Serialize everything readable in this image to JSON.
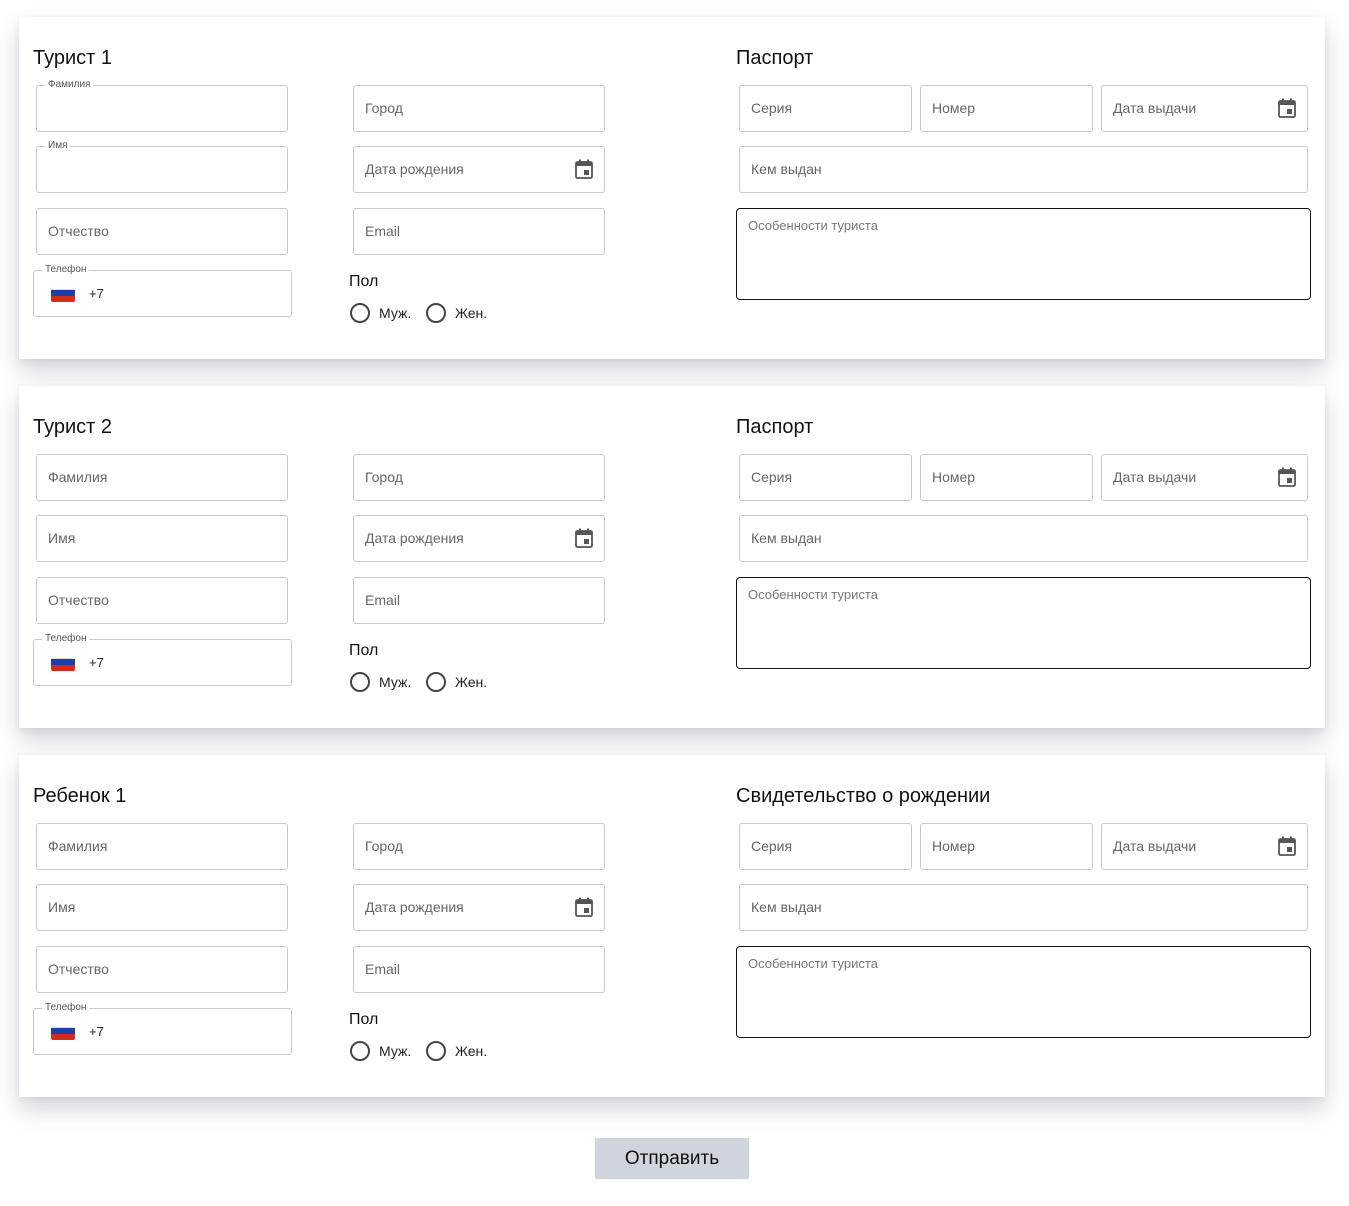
{
  "sections": [
    {
      "title": "Турист 1",
      "doc_title": "Паспорт",
      "last_name": {
        "label": "Фамилия"
      },
      "first_name": {
        "label": "Имя"
      },
      "patronymic": {
        "label": "Отчество"
      },
      "phone": {
        "label": "Телефон",
        "code": "+7"
      },
      "city": {
        "placeholder": "Город"
      },
      "birth_date": {
        "placeholder": "Дата рождения"
      },
      "email": {
        "placeholder": "Email"
      },
      "sex": {
        "label": "Пол",
        "male": "Муж.",
        "female": "Жен."
      },
      "doc_series": {
        "placeholder": "Серия"
      },
      "doc_number": {
        "placeholder": "Номер"
      },
      "doc_issue_date": {
        "placeholder": "Дата выдачи"
      },
      "doc_issued_by": {
        "placeholder": "Кем выдан"
      },
      "notes": {
        "placeholder": "Особенности туриста"
      }
    },
    {
      "title": "Турист 2",
      "doc_title": "Паспорт",
      "last_name": {
        "placeholder": "Фамилия"
      },
      "first_name": {
        "placeholder": "Имя"
      },
      "patronymic": {
        "placeholder": "Отчество"
      },
      "phone": {
        "label": "Телефон",
        "code": "+7"
      },
      "city": {
        "placeholder": "Город"
      },
      "birth_date": {
        "placeholder": "Дата рождения"
      },
      "email": {
        "placeholder": "Email"
      },
      "sex": {
        "label": "Пол",
        "male": "Муж.",
        "female": "Жен."
      },
      "doc_series": {
        "placeholder": "Серия"
      },
      "doc_number": {
        "placeholder": "Номер"
      },
      "doc_issue_date": {
        "placeholder": "Дата выдачи"
      },
      "doc_issued_by": {
        "placeholder": "Кем выдан"
      },
      "notes": {
        "placeholder": "Особенности туриста"
      }
    },
    {
      "title": "Ребенок 1",
      "doc_title": "Свидетельство о рождении",
      "last_name": {
        "placeholder": "Фамилия"
      },
      "first_name": {
        "placeholder": "Имя"
      },
      "patronymic": {
        "placeholder": "Отчество"
      },
      "phone": {
        "label": "Телефон",
        "code": "+7"
      },
      "city": {
        "placeholder": "Город"
      },
      "birth_date": {
        "placeholder": "Дата рождения"
      },
      "email": {
        "placeholder": "Email"
      },
      "sex": {
        "label": "Пол",
        "male": "Муж.",
        "female": "Жен."
      },
      "doc_series": {
        "placeholder": "Серия"
      },
      "doc_number": {
        "placeholder": "Номер"
      },
      "doc_issue_date": {
        "placeholder": "Дата выдачи"
      },
      "doc_issued_by": {
        "placeholder": "Кем выдан"
      },
      "notes": {
        "placeholder": "Особенности туриста"
      }
    }
  ],
  "flag_colors": [
    "#ffffff",
    "#1c3fa6",
    "#d52b1e"
  ],
  "icons": {
    "date_picker": "calendar-icon",
    "country_flag": "russia-flag-icon"
  },
  "submit_label": "Отправить"
}
